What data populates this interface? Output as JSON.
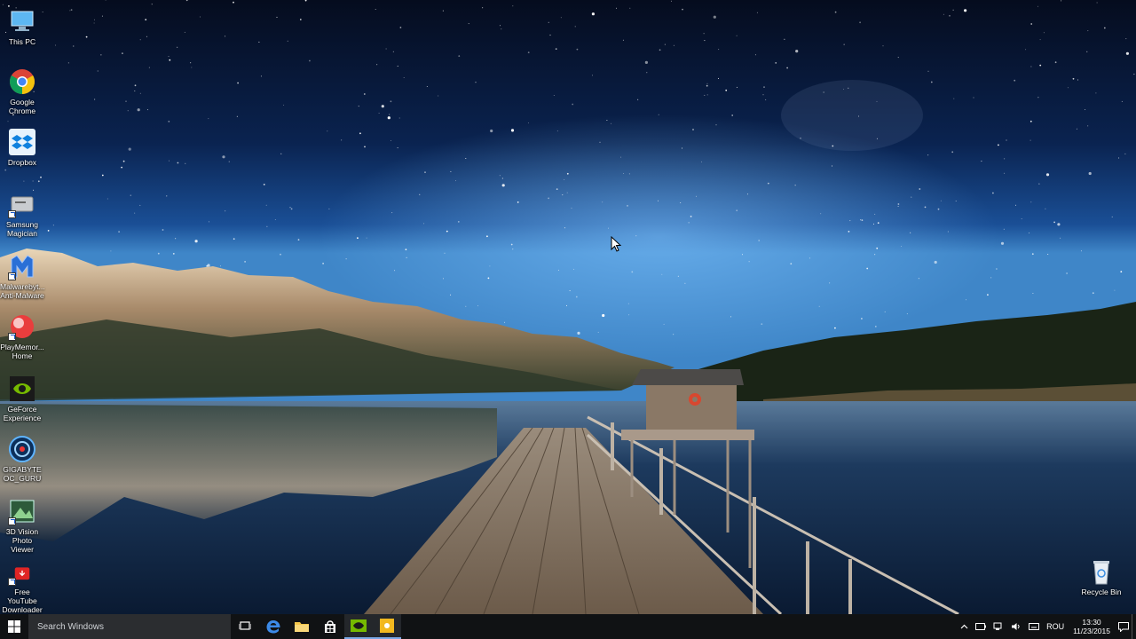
{
  "desktop": {
    "icons": [
      {
        "label": "This PC",
        "icon": "this-pc-icon"
      },
      {
        "label": "Google Chrome",
        "icon": "chrome-icon"
      },
      {
        "label": "Dropbox",
        "icon": "dropbox-icon"
      },
      {
        "label": "Samsung Magician",
        "icon": "samsung-magician-icon"
      },
      {
        "label": "Malwarebyt... Anti-Malware",
        "icon": "malwarebytes-icon"
      },
      {
        "label": "PlayMemor... Home",
        "icon": "playmemories-icon"
      },
      {
        "label": "GeForce Experience",
        "icon": "geforce-icon"
      },
      {
        "label": "GIGABYTE OC_GURU",
        "icon": "gigabyte-icon"
      },
      {
        "label": "3D Vision Photo Viewer",
        "icon": "3d-vision-icon"
      },
      {
        "label": "Free YouTube Downloader",
        "icon": "youtube-downloader-icon"
      }
    ],
    "recycle_bin": {
      "label": "Recycle Bin",
      "icon": "recycle-bin-icon"
    }
  },
  "taskbar": {
    "search_placeholder": "Search Windows",
    "pinned": [
      {
        "name": "task-view",
        "icon": "task-view-icon"
      },
      {
        "name": "edge",
        "icon": "edge-icon"
      },
      {
        "name": "file-explorer",
        "icon": "folder-icon"
      },
      {
        "name": "store",
        "icon": "store-icon"
      },
      {
        "name": "geforce",
        "icon": "nvidia-icon"
      },
      {
        "name": "app",
        "icon": "yellow-app-icon"
      }
    ],
    "tray": {
      "language": "ROU",
      "time": "13:30",
      "date": "11/23/2015"
    }
  },
  "colors": {
    "taskbar_bg": "#101214",
    "search_bg": "#2b2d30",
    "accent": "#7aa8e8"
  }
}
